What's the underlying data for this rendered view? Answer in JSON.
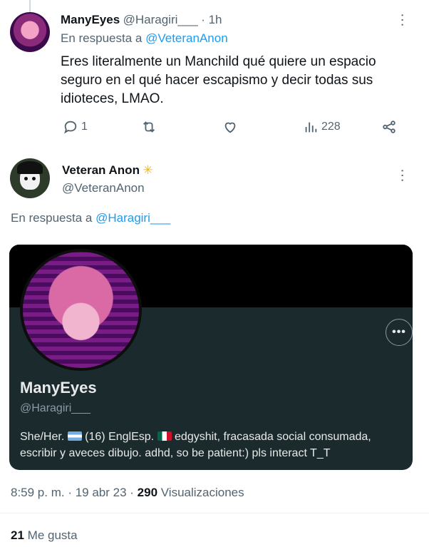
{
  "reply_tweet": {
    "author_name": "ManyEyes",
    "author_handle": "@Haragiri___",
    "time": "· 1h",
    "reply_prefix": "En respuesta a",
    "reply_to": "@VeteranAnon",
    "text_lines": [
      "Eres literalmente un Manchild qué quiere un espacio",
      "seguro en el qué hacer escapismo y decir todas sus",
      "idioteces, LMAO."
    ],
    "replies_count": "1",
    "views_count": "228",
    "icons": [
      "reply-icon",
      "retweet-icon",
      "like-icon",
      "views-icon",
      "share-icon"
    ]
  },
  "main_tweet": {
    "author_name": "Veteran Anon",
    "verified_emoji": "✳️",
    "author_handle": "@VeteranAnon",
    "reply_prefix": "En respuesta a",
    "reply_to": "@Haragiri___"
  },
  "profile_card": {
    "name": "ManyEyes",
    "handle": "@Haragiri___",
    "more": "•••",
    "bio_line1_a": "She/Her.",
    "bio_line1_b": "(16) EnglEsp.",
    "bio_line1_c": "edgyshit, fracasada social consumada,",
    "bio_line2": "escribir y aveces dibujo. adhd, so be patient:) pls interact T_T"
  },
  "meta": {
    "timestamp": "8:59 p. m. · 19 abr 23 ·",
    "views": "290",
    "views_label": "Visualizaciones",
    "likes": "21",
    "likes_label": "Me gusta"
  },
  "colors": {
    "link": "#1d9bf0",
    "secondary": "#536471",
    "card_bg": "#1b2b2d"
  }
}
